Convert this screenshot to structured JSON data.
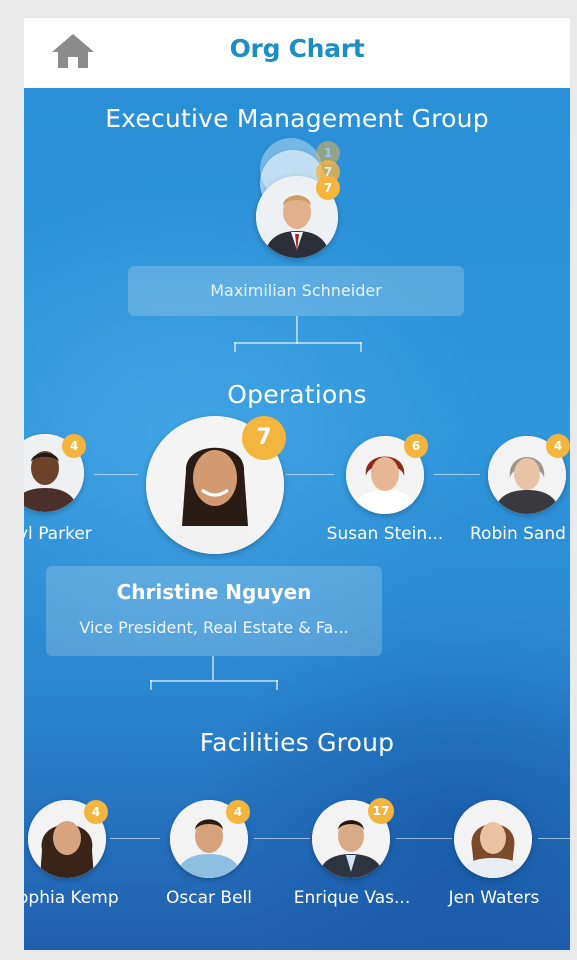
{
  "header": {
    "title": "Org Chart",
    "home_icon": "home-icon"
  },
  "groups": {
    "executive": {
      "title": "Executive Management Group",
      "stack_badges": [
        "1",
        "7",
        "7"
      ],
      "person": {
        "name": "Maximilian Schneider"
      }
    },
    "operations": {
      "title": "Operations",
      "selected": {
        "name": "Christine Nguyen",
        "role": "Vice President, Real Estate & Fa...",
        "badge": "7"
      },
      "left": {
        "name": "yl Parker",
        "badge": "4"
      },
      "right1": {
        "name": "Susan Stein...",
        "badge": "6"
      },
      "right2": {
        "name": "Robin Sand",
        "badge": "4"
      }
    },
    "facilities": {
      "title": "Facilities Group",
      "people": [
        {
          "name": "ophia Kemp",
          "badge": "4"
        },
        {
          "name": "Oscar Bell",
          "badge": "4"
        },
        {
          "name": "Enrique Vas...",
          "badge": "17"
        },
        {
          "name": "Jen Waters",
          "badge": ""
        }
      ]
    }
  },
  "colors": {
    "accent": "#1d8ec4",
    "badge": "#f4b53f",
    "background": "#2a8fd6"
  }
}
